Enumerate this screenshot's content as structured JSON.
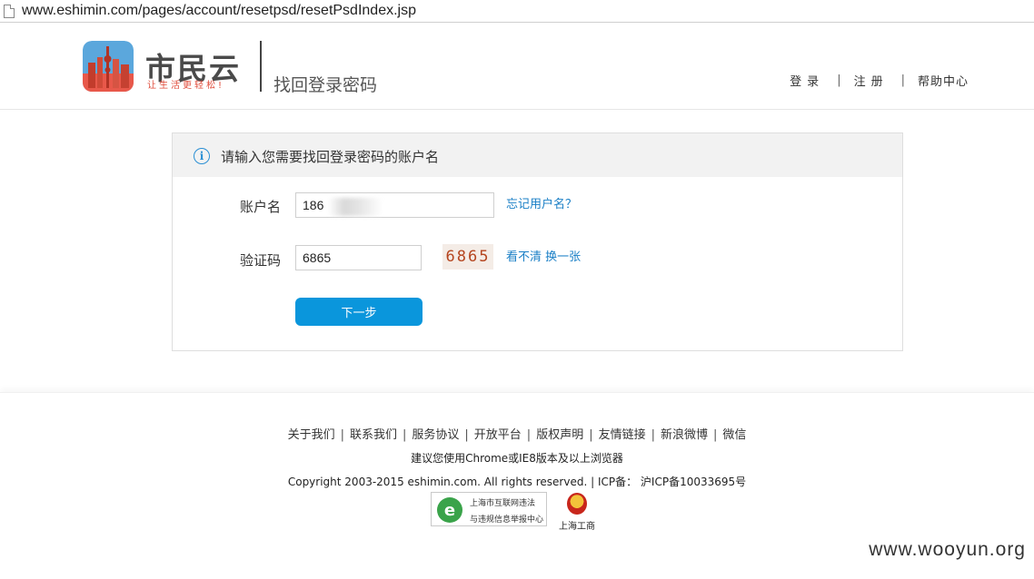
{
  "browser": {
    "url": "www.eshimin.com/pages/account/resetpsd/resetPsdIndex.jsp"
  },
  "header": {
    "logo_text": "市民云",
    "logo_slogan": "让生活更轻松!",
    "title": "找回登录密码",
    "nav": {
      "login": "登录",
      "register": "注册",
      "help": "帮助中心",
      "separator": "|"
    }
  },
  "form": {
    "heading": "请输入您需要找回登录密码的账户名",
    "account_label": "账户名",
    "account_value": "186",
    "forgot_username_link": "忘记用户名？",
    "captcha_label": "验证码",
    "captcha_value": "6865",
    "captcha_image_text": "6865",
    "refresh_captcha_link": "看不清 换一张",
    "next_button": "下一步"
  },
  "footer": {
    "links": [
      "关于我们",
      "联系我们",
      "服务协议",
      "开放平台",
      "版权声明",
      "友情链接",
      "新浪微博",
      "微信"
    ],
    "link_separator": "|",
    "browser_note": "建议您使用Chrome或IE8版本及以上浏览器",
    "copyright": "Copyright 2003-2015 eshimin.com. All rights reserved. | ICP备： 沪ICP备10033695号",
    "badge1_line1": "上海市互联网违法",
    "badge1_line2": "与违规信息举报中心",
    "badge2_text": "上海工商"
  },
  "watermark": "www.wooyun.org",
  "colors": {
    "accent": "#0a96dc",
    "link": "#1a7fc6",
    "captcha_text": "#b5451f"
  }
}
